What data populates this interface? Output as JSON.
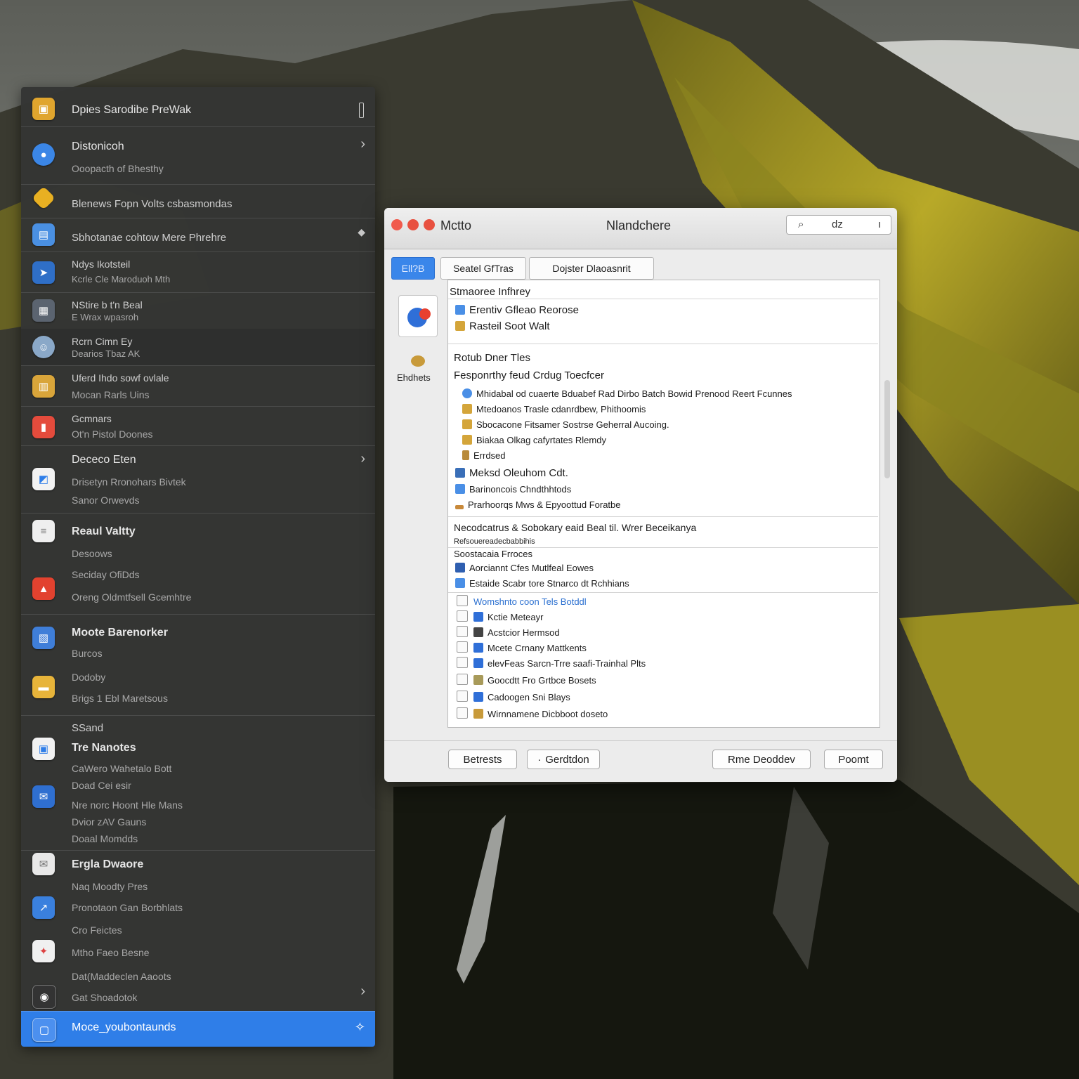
{
  "sidebar": {
    "header_title": "Dpies Sarodibe PreWak",
    "rows": [
      {
        "t1": "Distonicoh",
        "t2": "Ooopacth of Bhesthy"
      },
      {
        "t1": "Blenews Fopn Volts csbasmondas"
      },
      {
        "t1": "Sbhotanae cohtow Mere Phrehre"
      },
      {
        "t1": "Ndys Ikotsteil",
        "t2": "Kcrle Cle Maroduoh Mth"
      },
      {
        "t1": "NStire b t'n Beal",
        "t2": "E Wrax wpasroh"
      },
      {
        "t1": "Rcrn Cimn Ey",
        "t2": "Dearios Tbaz AK"
      },
      {
        "t1": "Uferd Ihdo sowf ovlale",
        "t2": "Mocan Rarls Uins"
      },
      {
        "t1": "Gcmnars",
        "t2": "Ot'n Pistol Doones"
      },
      {
        "t1": "Dececo Eten",
        "t2": "Drisetyn Rronohars Bivtek",
        "t3": "Sanor Orwevds"
      },
      {
        "t1": "Reaul Valtty",
        "t2": "Desoows",
        "t3": "Seciday OfiDds",
        "t4": "Oreng Oldmtfsell Gcemhtre"
      },
      {
        "t1": "Moote Barenorker",
        "t2": "Burcos",
        "t3": "Dodoby",
        "t4": "Brigs 1 Ebl Maretsous"
      },
      {
        "t1": "SSand",
        "t2": "Tre Nanotes",
        "t3": "CaWero Wahetalo Bott",
        "t4": "Doad Cei esir",
        "t5": "Nre norc Hoont Hle Mans",
        "t6": "Dvior zAV Gauns",
        "t7": "Doaal Momdds"
      },
      {
        "t1": "Ergla Dwaore",
        "t2": "Naq Moodty Pres",
        "t3": "Pronotaon Gan Borbhlats",
        "t4": "Cro Feictes",
        "t5": "Mtho Faeo Besne",
        "t6": "Dat(Maddeclen Aaoots",
        "t7": "Gat Shoadotok"
      }
    ],
    "footer_label": "Moce_youbontaunds"
  },
  "window": {
    "app_name": "Mctto",
    "title": "Nlandchere",
    "search_text": "dz",
    "tabs": [
      "Ell?B",
      "Seatel GfTras",
      "Dojster Dlaoasnrit"
    ],
    "left_label": "Ehdhets",
    "sections": {
      "s1_title": "Stmaoree Infhrey",
      "s1_items": [
        "Erentiv Gfleao Reorose",
        "Rasteil Soot Walt"
      ],
      "s2_title": "Rotub Dner Tles",
      "s2_sub": "Fesponrthy feud Crdug Toecfcer",
      "s2_nested": [
        "Mhidabal od cuaerte Bduabef Rad Dirbo Batch Bowid Prenood Reert Fcunnes",
        "Mtedoanos Trasle cdanrdbew, Phithoomis",
        "Sbocacone Fitsamer Sostrse Geherral Aucoing.",
        "Biakaa Olkag cafyrtates Rlemdy",
        "Errdsed"
      ],
      "s2_items": [
        "Meksd Oleuhom Cdt.",
        "Barinoncois Chndthhtods",
        "Prarhoorqs Mws & Epyoottud Foratbe"
      ],
      "s3_title": "Necodcatrus & Sobokary eaid Beal til. Wrer Beceikanya",
      "s3_small": "Refsouereadecbabbihis",
      "s3_sub": "Soostacaia Frroces",
      "s3_items": [
        "Aorciannt Cfes Mutlfeal Eowes",
        "Estaide Scabr tore Stnarco dt Rchhians"
      ],
      "s4_items": [
        "Womshnto coon Tels Botddl",
        "Kctie Meteayr",
        "Acstcior Hermsod",
        "Mcete Crnany Mattkents",
        "elevFeas Sarcn-Trre saafi-Trainhal Plts",
        "Goocdtt Fro Grtbce Bosets",
        "Cadoogen Sni Blays",
        "Wirnnamene Dicbboot doseto"
      ]
    },
    "buttons": [
      "Betrests",
      "Gerdtdon",
      "Rme Deoddev",
      "Poomt"
    ]
  },
  "colors": {
    "accent": "#3a86ea",
    "sidebar_bg": "#343534",
    "close": "#f05a4c",
    "minimize": "#f5a623",
    "zoom": "#e8503f"
  }
}
